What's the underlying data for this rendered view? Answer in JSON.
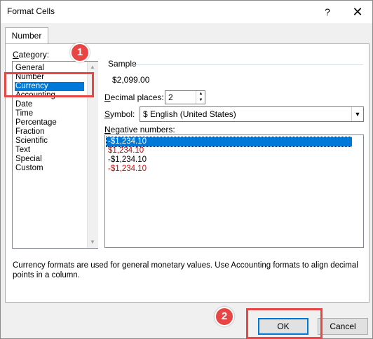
{
  "window": {
    "title": "Format Cells",
    "help_glyph": "?",
    "close_glyph": "✕"
  },
  "tabs": [
    {
      "label": "Number",
      "active": true
    }
  ],
  "category": {
    "label": "Category:",
    "items": [
      "General",
      "Number",
      "Currency",
      "Accounting",
      "Date",
      "Time",
      "Percentage",
      "Fraction",
      "Scientific",
      "Text",
      "Special",
      "Custom"
    ],
    "selected": "Currency"
  },
  "sample": {
    "label": "Sample",
    "value": "$2,099.00"
  },
  "decimal_places": {
    "label": "Decimal places:",
    "value": "2"
  },
  "symbol": {
    "label": "Symbol:",
    "value": "$ English (United States)"
  },
  "negative_numbers": {
    "label": "Negative numbers:",
    "items": [
      {
        "text": "-$1,234.10",
        "color": "#000000",
        "selected": true
      },
      {
        "text": "$1,234.10",
        "color": "#e00000",
        "selected": false
      },
      {
        "text": "-$1,234.10",
        "color": "#000000",
        "selected": false
      },
      {
        "text": "-$1,234.10",
        "color": "#e00000",
        "selected": false
      }
    ]
  },
  "description": "Currency formats are used for general monetary values.  Use Accounting formats to align decimal points in a column.",
  "buttons": {
    "ok": "OK",
    "cancel": "Cancel"
  },
  "annotations": {
    "badge_1": "1",
    "badge_2": "2",
    "highlight_color": "#e84545"
  }
}
